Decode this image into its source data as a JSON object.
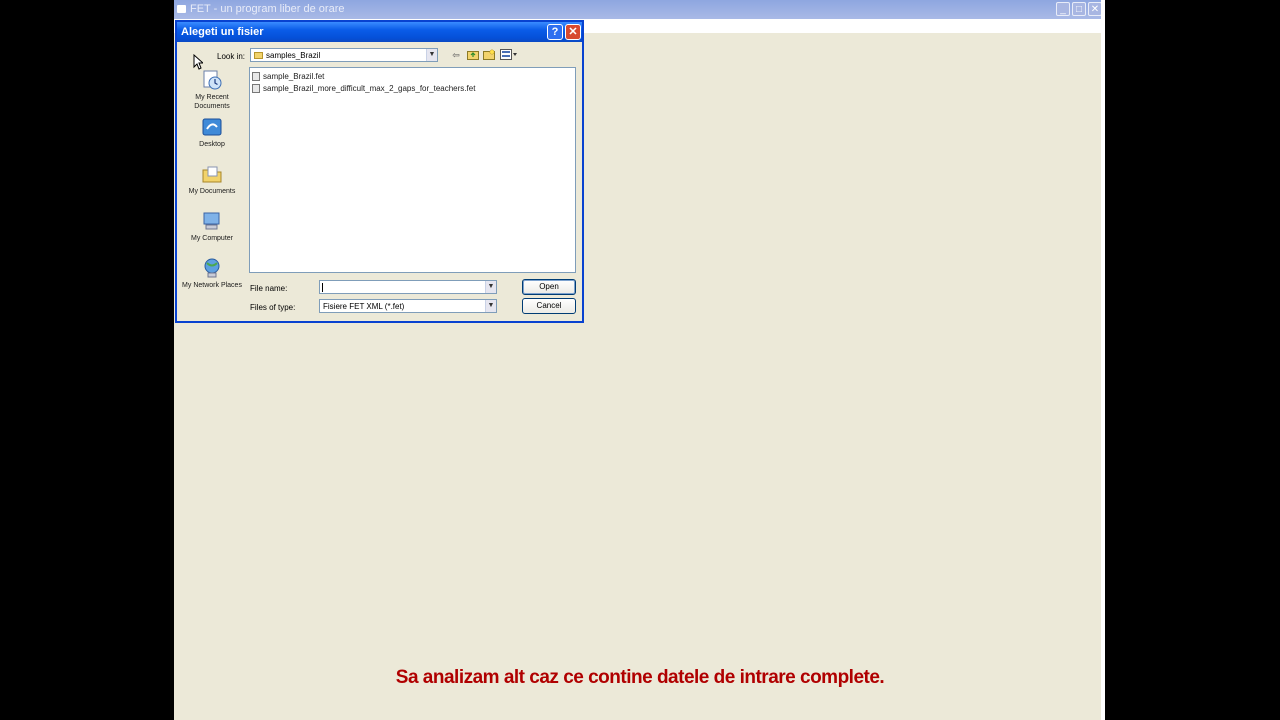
{
  "app_window": {
    "title": "FET - un program liber de orare"
  },
  "dialog": {
    "title": "Alegeti un fisier",
    "help_label": "?",
    "close_label": "✕",
    "look_in": {
      "label": "Look in:",
      "value": "samples_Brazil"
    },
    "toolbar_icons": [
      "back-arrow-icon",
      "up-folder-icon",
      "new-folder-icon",
      "view-menu-icon"
    ],
    "places": [
      {
        "label": "My Recent Documents",
        "icon": "recent-documents-icon"
      },
      {
        "label": "Desktop",
        "icon": "desktop-icon"
      },
      {
        "label": "My Documents",
        "icon": "my-documents-icon"
      },
      {
        "label": "My Computer",
        "icon": "my-computer-icon"
      },
      {
        "label": "My Network Places",
        "icon": "network-places-icon"
      }
    ],
    "files": [
      "sample_Brazil.fet",
      "sample_Brazil_more_difficult_max_2_gaps_for_teachers.fet"
    ],
    "file_name": {
      "label": "File name:",
      "value": ""
    },
    "file_type": {
      "label": "Files of type:",
      "value": "Fisiere FET XML (*.fet)"
    },
    "open_label": "Open",
    "cancel_label": "Cancel"
  },
  "subtitle": "Sa analizam alt caz ce contine datele de intrare complete.",
  "colors": {
    "desktop_bg": "#ECE9D8",
    "dialog_title_blue": "#0A5CE8",
    "close_red": "#D7492F",
    "subtitle_red": "#B00000"
  }
}
